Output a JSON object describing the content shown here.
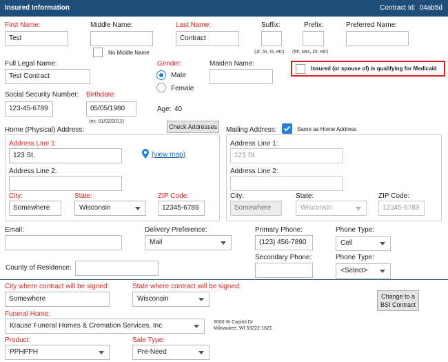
{
  "header": {
    "title": "Insured Information",
    "contract_id_label": "Contract Id:",
    "contract_id_value": "04ab5d"
  },
  "colors": {
    "header_bg": "#1f4e79",
    "required": "#e02020",
    "accent": "#2a7fd4",
    "medicaid_border": "#e02020"
  },
  "name": {
    "first_label": "First Name:",
    "first_value": "Test",
    "middle_label": "Middle Name:",
    "middle_value": "",
    "no_middle_label": "No Middle Name",
    "last_label": "Last Name:",
    "last_value": "Contract",
    "suffix_label": "Suffix:",
    "suffix_value": "",
    "suffix_hint": "(Jr, Sr, III, etc)",
    "prefix_label": "Prefix:",
    "prefix_value": "",
    "prefix_hint": "(Mr, Mrs, Dr, etc)",
    "preferred_label": "Preferred Name:",
    "preferred_value": "",
    "legal_label": "Full Legal Name:",
    "legal_value": "Test Contract",
    "maiden_label": "Maiden Name:",
    "maiden_value": ""
  },
  "gender": {
    "label": "Gender:",
    "male": "Male",
    "female": "Female",
    "selected": "Male"
  },
  "medicaid": {
    "label": "Insured (or spouse of) is qualifying for Medicaid",
    "checked": false
  },
  "ssn": {
    "label": "Social Security Number:",
    "value": "123-45-6789"
  },
  "birthdate": {
    "label": "Birthdate:",
    "value": "05/05/1980",
    "hint": "(ex. 01/02/2012)"
  },
  "age": {
    "label": "Age:",
    "value": "40"
  },
  "check_addresses_button": "Check Addresses",
  "home_address": {
    "title": "Home (Physical) Address:",
    "line1_label": "Address Line 1:",
    "line1_value": "123 St.",
    "view_map": "(view map)",
    "line2_label": "Address Line 2:",
    "line2_value": "",
    "city_label": "City:",
    "city_value": "Somewhere",
    "state_label": "State:",
    "state_value": "Wisconsin",
    "zip_label": "ZIP Code:",
    "zip_value": "12345-6789"
  },
  "mailing_address": {
    "title": "Mailing Address:",
    "same_as_home_label": "Same as Home Address",
    "same_as_home_checked": true,
    "line1_label": "Address Line 1:",
    "line1_value": "123 St.",
    "line2_label": "Address Line 2:",
    "line2_value": "",
    "city_label": "City:",
    "city_value": "Somewhere",
    "state_label": "State:",
    "state_value": "Wisconsin",
    "zip_label": "ZIP Code:",
    "zip_value": "12345-6789"
  },
  "contact": {
    "email_label": "Email:",
    "email_value": "",
    "delivery_label": "Delivery Preference:",
    "delivery_value": "Mail",
    "primary_phone_label": "Primary Phone:",
    "primary_phone_value": "(123) 456-7890",
    "phone_type_label": "Phone Type:",
    "phone_type_value": "Cell",
    "secondary_phone_label": "Secondary Phone:",
    "secondary_phone_value": "",
    "phone_type2_label": "Phone Type:",
    "phone_type2_value": "<Select>",
    "county_label": "County of Residence:",
    "county_value": ""
  },
  "contract": {
    "city_signed_label": "City where contract will be signed:",
    "city_signed_value": "Somewhere",
    "state_signed_label": "State where contract will be signed:",
    "state_signed_value": "Wisconsin",
    "change_bsi_button_line1": "Change to a",
    "change_bsi_button_line2": "BSI Contract",
    "funeral_home_label": "Funeral Home:",
    "funeral_home_value": "Krause Funeral Homes & Cremation Services, Inc",
    "funeral_home_address_line1": "9000 W Capitol Dr",
    "funeral_home_address_line2": "Milwaukee, WI 53222-1621",
    "product_label": "Product:",
    "product_value": "PPHPPH",
    "sale_type_label": "Sale Type:",
    "sale_type_value": "Pre-Need"
  },
  "icons": {
    "map_pin": "map-pin-icon",
    "dropdown": "chevron-down-icon",
    "checkmark": "checkmark-icon"
  }
}
